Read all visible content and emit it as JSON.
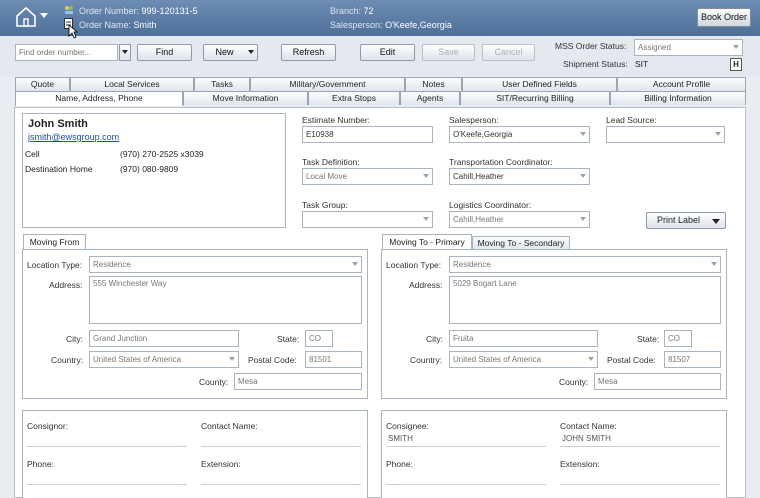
{
  "header": {
    "order_number_label": "Order Number:",
    "order_number": "999-120131-5",
    "order_name_label": "Order Name:",
    "order_name": "Smith",
    "branch_label": "Branch:",
    "branch": "72",
    "salesperson_label": "Salesperson:",
    "salesperson": "O'Keefe,Georgia",
    "book_order": "Book Order"
  },
  "toolbar": {
    "find_placeholder": "Find order number...",
    "find": "Find",
    "new": "New",
    "refresh": "Refresh",
    "edit": "Edit",
    "save": "Save",
    "cancel": "Cancel",
    "mss_status_label": "MSS Order Status:",
    "mss_status": "Assigned",
    "shipment_status_label": "Shipment Status:",
    "shipment_status": "SIT",
    "h_badge": "H"
  },
  "tabs_top": [
    "Quote",
    "Local Services",
    "Tasks",
    "Military/Government",
    "Notes",
    "User Defined Fields",
    "Account Profile"
  ],
  "tabs_bottom": [
    "Name, Address, Phone",
    "Move Information",
    "Extra Stops",
    "Agents",
    "SIT/Recurring Billing",
    "Billing Information"
  ],
  "contact": {
    "name": "John Smith",
    "email": "jsmith@ewsgroup.com",
    "rows": [
      {
        "label": "Cell",
        "value": "(970) 270-2525 x3039"
      },
      {
        "label": "Destination Home",
        "value": "(970) 080-9809"
      }
    ]
  },
  "fields": {
    "estimate_label": "Estimate Number:",
    "estimate": "E10938",
    "salesperson_label": "Salesperson:",
    "salesperson": "O'Keefe,Georgia",
    "lead_label": "Lead Source:",
    "lead": "",
    "task_def_label": "Task Definition:",
    "task_def": "Local Move",
    "transport_label": "Transportation Coordinator:",
    "transport": "Cahill,Heather",
    "task_group_label": "Task Group:",
    "task_group": "",
    "logistics_label": "Logistics Coordinator:",
    "logistics": "Cahill,Heather",
    "print_label": "Print Label"
  },
  "moving_from": {
    "tab": "Moving From",
    "location_type_label": "Location Type:",
    "location_type": "Residence",
    "address_label": "Address:",
    "address": "555 Winchester Way",
    "city_label": "City:",
    "city": "Grand Junction",
    "state_label": "State:",
    "state": "CO",
    "country_label": "Country:",
    "country": "United States of America",
    "postal_label": "Postal Code:",
    "postal": "81501",
    "county_label": "County:",
    "county": "Mesa"
  },
  "moving_to": {
    "tab_primary": "Moving To - Primary",
    "tab_secondary": "Moving To - Secondary",
    "location_type_label": "Location Type:",
    "location_type": "Residence",
    "address_label": "Address:",
    "address": "5029 Bogart Lane",
    "city_label": "City:",
    "city": "Fruita",
    "state_label": "State:",
    "state": "CO",
    "country_label": "Country:",
    "country": "United States of America",
    "postal_label": "Postal Code:",
    "postal": "81507",
    "county_label": "County:",
    "county": "Mesa"
  },
  "consignor": {
    "consignor_label": "Consignor:",
    "consignor": "",
    "contact_label": "Contact Name:",
    "contact": "",
    "phone_label": "Phone:",
    "extension_label": "Extension:"
  },
  "consignee": {
    "consignee_label": "Consignee:",
    "consignee": "SMITH",
    "contact_label": "Contact Name:",
    "contact": "JOHN SMITH",
    "phone_label": "Phone:",
    "extension_label": "Extension:"
  },
  "colors": {
    "header": "#5a7aa4",
    "link": "#1b4fb3"
  }
}
